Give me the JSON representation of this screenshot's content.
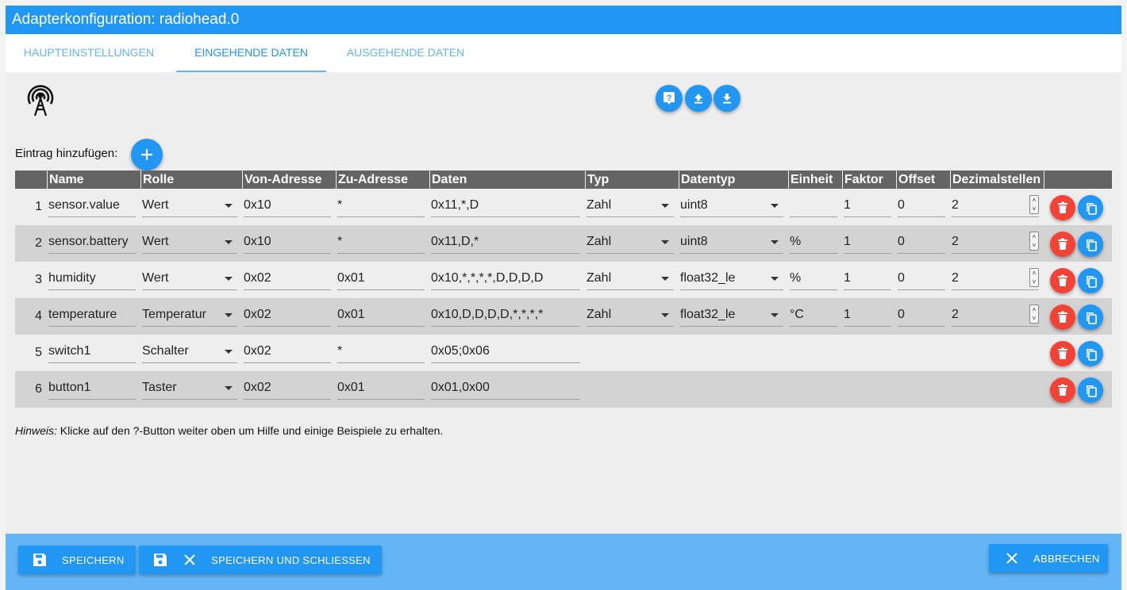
{
  "window": {
    "title": "Adapterkonfiguration: radiohead.0"
  },
  "tabs": [
    {
      "label": "HAUPTEINSTELLUNGEN",
      "active": false
    },
    {
      "label": "EINGEHENDE DATEN",
      "active": true
    },
    {
      "label": "AUSGEHENDE DATEN",
      "active": false
    }
  ],
  "toolbar": {
    "icons": [
      "help-icon",
      "upload-icon",
      "download-icon"
    ]
  },
  "add_entry": {
    "label": "Eintrag hinzufügen:"
  },
  "table": {
    "columns": [
      "Name",
      "Rolle",
      "Von-Adresse",
      "Zu-Adresse",
      "Daten",
      "Typ",
      "Datentyp",
      "Einheit",
      "Faktor",
      "Offset",
      "Dezimalstellen"
    ],
    "rows": [
      {
        "num": "1",
        "name": "sensor.value",
        "rolle": "Wert",
        "von": "0x10",
        "zu": "*",
        "daten": "0x11,*,D",
        "typ": "Zahl",
        "datentyp": "uint8",
        "einheit": "",
        "faktor": "1",
        "offset": "0",
        "dezimal": "2"
      },
      {
        "num": "2",
        "name": "sensor.battery",
        "rolle": "Wert",
        "von": "0x10",
        "zu": "*",
        "daten": "0x11,D,*",
        "typ": "Zahl",
        "datentyp": "uint8",
        "einheit": "%",
        "faktor": "1",
        "offset": "0",
        "dezimal": "2"
      },
      {
        "num": "3",
        "name": "humidity",
        "rolle": "Wert",
        "von": "0x02",
        "zu": "0x01",
        "daten": "0x10,*,*,*,*,D,D,D,D",
        "typ": "Zahl",
        "datentyp": "float32_le",
        "einheit": "%",
        "faktor": "1",
        "offset": "0",
        "dezimal": "2"
      },
      {
        "num": "4",
        "name": "temperature",
        "rolle": "Temperatur",
        "von": "0x02",
        "zu": "0x01",
        "daten": "0x10,D,D,D,D,*,*,*,*",
        "typ": "Zahl",
        "datentyp": "float32_le",
        "einheit": "°C",
        "faktor": "1",
        "offset": "0",
        "dezimal": "2"
      },
      {
        "num": "5",
        "name": "switch1",
        "rolle": "Schalter",
        "von": "0x02",
        "zu": "*",
        "daten": "0x05;0x06"
      },
      {
        "num": "6",
        "name": "button1",
        "rolle": "Taster",
        "von": "0x02",
        "zu": "0x01",
        "daten": "0x01,0x00"
      }
    ]
  },
  "hint": {
    "prefix": "Hinweis:",
    "text": " Klicke auf den ?-Button weiter oben um Hilfe und einige Beispiele zu erhalten."
  },
  "footer": {
    "save": "SPEICHERN",
    "save_close": "SPEICHERN UND SCHLIESSEN",
    "cancel": "ABBRECHEN"
  },
  "colors": {
    "primary": "#2196f3",
    "primary_light": "#64b5f6",
    "danger": "#f44336",
    "header_gray": "#646464"
  }
}
